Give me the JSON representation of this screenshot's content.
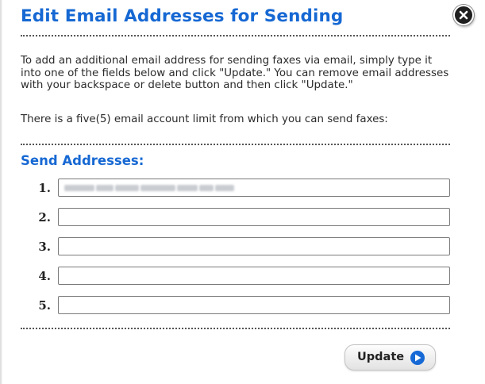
{
  "dialog": {
    "title": "Edit Email Addresses for Sending",
    "close_icon": "close-circle-icon"
  },
  "intro": {
    "text": "To add an additional email address for sending faxes via email, simply type it into one of the fields below and click \"Update.\" You can remove email addresses with your backspace or delete button and then click \"Update.\"",
    "limit_text": "There is a five(5) email account limit from which you can send faxes:"
  },
  "send_addresses": {
    "heading": "Send Addresses:",
    "rows": [
      {
        "number": "1.",
        "value": "",
        "blurred": true
      },
      {
        "number": "2.",
        "value": ""
      },
      {
        "number": "3.",
        "value": ""
      },
      {
        "number": "4.",
        "value": ""
      },
      {
        "number": "5.",
        "value": ""
      }
    ]
  },
  "actions": {
    "update_label": "Update",
    "update_icon": "arrow-right-circle-icon"
  },
  "colors": {
    "accent": "#1668d3",
    "text": "#2b2b2b"
  }
}
